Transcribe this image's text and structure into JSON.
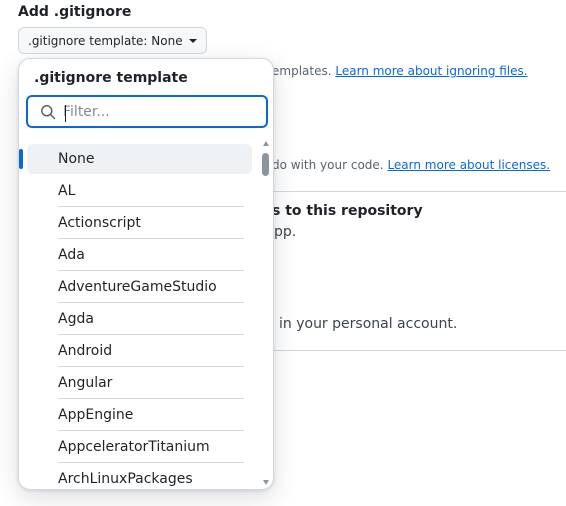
{
  "section": {
    "title": "Add .gitignore",
    "template_button": ".gitignore template: None"
  },
  "background": {
    "gitignore_help_text": "emplates.",
    "gitignore_help_link": "Learn more about ignoring files.",
    "license_help_text": "do with your code.",
    "license_help_link": "Learn more about licenses.",
    "repo_heading": "s to this repository",
    "repo_subtext": "pp.",
    "account_text": "in your personal account."
  },
  "dropdown": {
    "title": ".gitignore template",
    "filter_placeholder": "Filter...",
    "selected": "None",
    "items": [
      "None",
      "AL",
      "Actionscript",
      "Ada",
      "AdventureGameStudio",
      "Agda",
      "Android",
      "Angular",
      "AppEngine",
      "AppceleratorTitanium",
      "ArchLinuxPackages"
    ]
  },
  "colors": {
    "accent": "#0969da",
    "border": "#d1d9e0",
    "selected_bg": "#eff2f5"
  },
  "icons": {
    "search": "search-icon",
    "caret": "triangle-down-icon"
  }
}
